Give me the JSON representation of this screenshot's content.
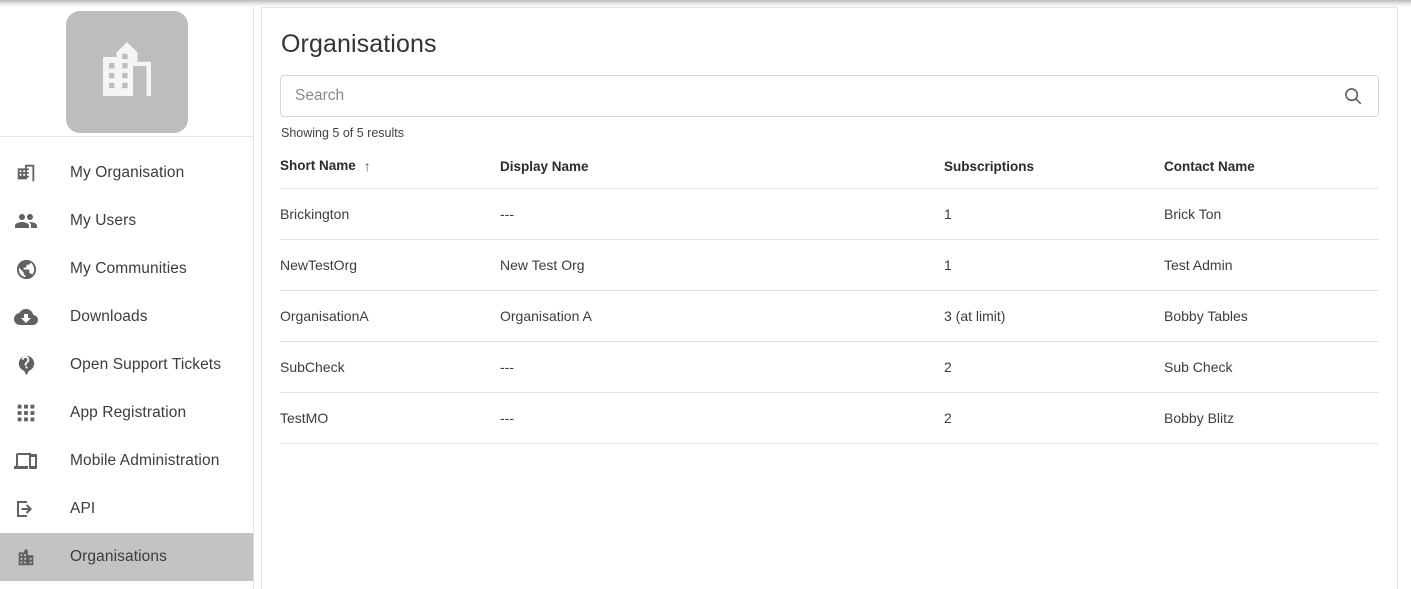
{
  "brand": {
    "logo_icon": "building-logo-icon",
    "logo_bg": "#bdbdbd",
    "logo_fg": "#f5f5f5"
  },
  "sidebar": {
    "active_item": "Organisations",
    "active_bg": "#c3c3c3",
    "items": [
      {
        "label": "My Organisation",
        "icon": "building-icon",
        "active": false
      },
      {
        "label": "My Users",
        "icon": "people-icon",
        "active": false
      },
      {
        "label": "My Communities",
        "icon": "globe-icon",
        "active": false
      },
      {
        "label": "Downloads",
        "icon": "cloud-download-icon",
        "active": false
      },
      {
        "label": "Open Support Tickets",
        "icon": "help-balloon-icon",
        "active": false
      },
      {
        "label": "App Registration",
        "icon": "apps-grid-icon",
        "active": false
      },
      {
        "label": "Mobile Administration",
        "icon": "devices-icon",
        "active": false
      },
      {
        "label": "API",
        "icon": "login-arrow-icon",
        "active": false
      },
      {
        "label": "Organisations",
        "icon": "organisations-icon",
        "active": true
      }
    ]
  },
  "main": {
    "title": "Organisations",
    "search": {
      "placeholder": "Search",
      "value": "",
      "button_icon": "search-icon"
    },
    "results_text": "Showing 5 of 5 results",
    "table": {
      "sort_column": "Short Name",
      "sort_direction": "ascending",
      "sort_arrow": "↑",
      "columns": [
        {
          "key": "short",
          "label": "Short Name"
        },
        {
          "key": "display",
          "label": "Display Name"
        },
        {
          "key": "subs",
          "label": "Subscriptions"
        },
        {
          "key": "contact",
          "label": "Contact Name"
        }
      ],
      "rows": [
        {
          "short": "Brickington",
          "display": "---",
          "subs": "1",
          "contact": "Brick Ton"
        },
        {
          "short": "NewTestOrg",
          "display": "New Test Org",
          "subs": "1",
          "contact": "Test Admin"
        },
        {
          "short": "OrganisationA",
          "display": "Organisation A",
          "subs": "3 (at limit)",
          "contact": "Bobby Tables"
        },
        {
          "short": "SubCheck",
          "display": "---",
          "subs": "2",
          "contact": "Sub Check"
        },
        {
          "short": "TestMO",
          "display": "---",
          "subs": "2",
          "contact": "Bobby Blitz"
        }
      ]
    }
  }
}
